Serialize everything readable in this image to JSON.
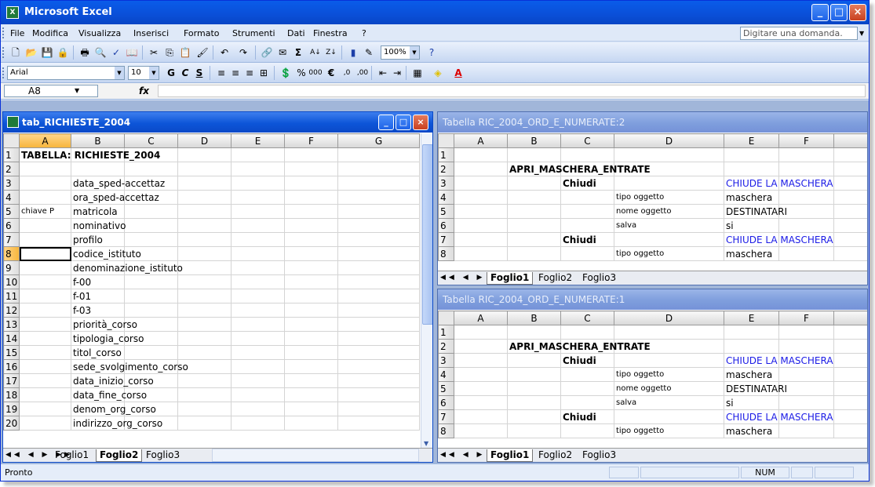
{
  "app": {
    "title": "Microsoft Excel"
  },
  "menu": {
    "items": [
      "File",
      "Modifica",
      "Visualizza",
      "Inserisci",
      "Formato",
      "Strumenti",
      "Dati",
      "Finestra",
      "?"
    ],
    "ask_placeholder": "Digitare una domanda."
  },
  "toolbar": {
    "zoom": "100%",
    "font_name": "Arial",
    "font_size": "10",
    "bold": "G",
    "italic": "C",
    "underline": "S"
  },
  "formula_bar": {
    "name_box": "A8",
    "fx": "fx"
  },
  "left_window": {
    "title": "tab_RICHIESTE_2004",
    "columns": [
      "A",
      "B",
      "C",
      "D",
      "E",
      "F",
      "G"
    ],
    "rows": [
      {
        "n": "1",
        "a": "TABELLA:  RICHIESTE_2004",
        "b": ""
      },
      {
        "n": "2",
        "a": "",
        "b": ""
      },
      {
        "n": "3",
        "a": "",
        "b": "data_sped-accettaz"
      },
      {
        "n": "4",
        "a": "",
        "b": "ora_sped-accettaz"
      },
      {
        "n": "5",
        "a": "chiave P",
        "b": "matricola"
      },
      {
        "n": "6",
        "a": "",
        "b": "nominativo"
      },
      {
        "n": "7",
        "a": "",
        "b": "profilo"
      },
      {
        "n": "8",
        "a": "",
        "b": "codice_istituto"
      },
      {
        "n": "9",
        "a": "",
        "b": "denominazione_istituto"
      },
      {
        "n": "10",
        "a": "",
        "b": "f-00"
      },
      {
        "n": "11",
        "a": "",
        "b": "f-01"
      },
      {
        "n": "12",
        "a": "",
        "b": "f-03"
      },
      {
        "n": "13",
        "a": "",
        "b": "priorità_corso"
      },
      {
        "n": "14",
        "a": "",
        "b": "tipologia_corso"
      },
      {
        "n": "15",
        "a": "",
        "b": "titol_corso"
      },
      {
        "n": "16",
        "a": "",
        "b": "sede_svolgimento_corso"
      },
      {
        "n": "17",
        "a": "",
        "b": "data_inizio_corso"
      },
      {
        "n": "18",
        "a": "",
        "b": "data_fine_corso"
      },
      {
        "n": "19",
        "a": "",
        "b": "denom_org_corso"
      },
      {
        "n": "20",
        "a": "",
        "b": "indirizzo_org_corso"
      }
    ],
    "sheets": [
      "Foglio1",
      "Foglio2",
      "Foglio3"
    ],
    "active_sheet": "Foglio2"
  },
  "right_top": {
    "title": "Tabella RIC_2004_ORD_E_NUMERATE:2",
    "columns": [
      "A",
      "B",
      "C",
      "D",
      "E",
      "F"
    ],
    "rows": [
      {
        "n": "1",
        "b": "",
        "c": "",
        "d": "",
        "e": ""
      },
      {
        "n": "2",
        "b": "APRI_MASCHERA_ENTRATE",
        "c": "",
        "d": "",
        "e": ""
      },
      {
        "n": "3",
        "b": "",
        "c": "Chiudi",
        "d": "",
        "e": "CHIUDE LA MASCHERA"
      },
      {
        "n": "4",
        "b": "",
        "c": "",
        "d": "tipo oggetto",
        "e": "maschera"
      },
      {
        "n": "5",
        "b": "",
        "c": "",
        "d": "nome oggetto",
        "e": "DESTINATARI"
      },
      {
        "n": "6",
        "b": "",
        "c": "",
        "d": "salva",
        "e": "si"
      },
      {
        "n": "7",
        "b": "",
        "c": "Chiudi",
        "d": "",
        "e": "CHIUDE LA MASCHERA"
      },
      {
        "n": "8",
        "b": "",
        "c": "",
        "d": "tipo oggetto",
        "e": "maschera"
      }
    ],
    "sheets": [
      "Foglio1",
      "Foglio2",
      "Foglio3"
    ],
    "active_sheet": "Foglio1"
  },
  "right_bottom": {
    "title": "Tabella RIC_2004_ORD_E_NUMERATE:1",
    "columns": [
      "A",
      "B",
      "C",
      "D",
      "E",
      "F"
    ],
    "rows": [
      {
        "n": "1",
        "b": "",
        "c": "",
        "d": "",
        "e": ""
      },
      {
        "n": "2",
        "b": "APRI_MASCHERA_ENTRATE",
        "c": "",
        "d": "",
        "e": ""
      },
      {
        "n": "3",
        "b": "",
        "c": "Chiudi",
        "d": "",
        "e": "CHIUDE LA MASCHERA"
      },
      {
        "n": "4",
        "b": "",
        "c": "",
        "d": "tipo oggetto",
        "e": "maschera"
      },
      {
        "n": "5",
        "b": "",
        "c": "",
        "d": "nome oggetto",
        "e": "DESTINATARI"
      },
      {
        "n": "6",
        "b": "",
        "c": "",
        "d": "salva",
        "e": "si"
      },
      {
        "n": "7",
        "b": "",
        "c": "Chiudi",
        "d": "",
        "e": "CHIUDE LA MASCHERA"
      },
      {
        "n": "8",
        "b": "",
        "c": "",
        "d": "tipo oggetto",
        "e": "maschera"
      }
    ],
    "sheets": [
      "Foglio1",
      "Foglio2",
      "Foglio3"
    ],
    "active_sheet": "Foglio1"
  },
  "status": {
    "text": "Pronto",
    "num": "NUM"
  }
}
